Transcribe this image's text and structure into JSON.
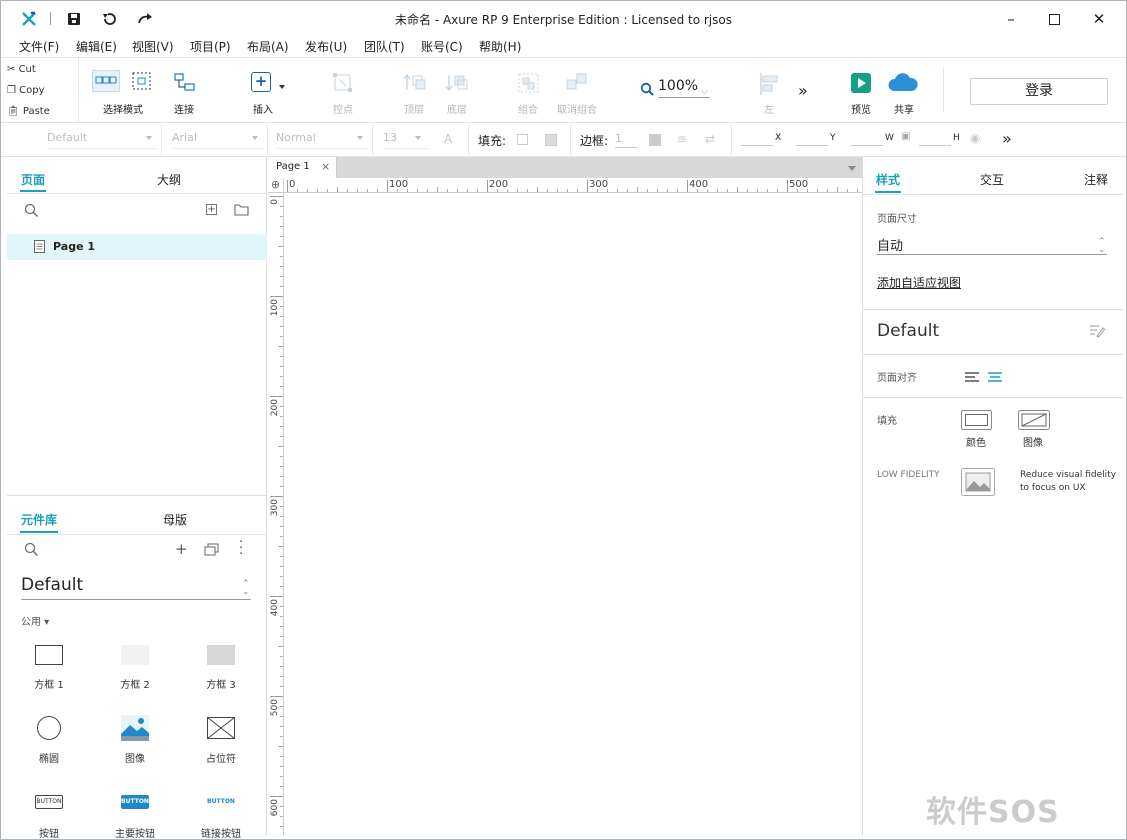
{
  "window": {
    "title": "未命名 - Axure RP 9 Enterprise Edition : Licensed to rjsos"
  },
  "menu": [
    "文件(F)",
    "编辑(E)",
    "视图(V)",
    "项目(P)",
    "布局(A)",
    "发布(U)",
    "团队(T)",
    "账号(C)",
    "帮助(H)"
  ],
  "clipboard": {
    "cut": "Cut",
    "copy": "Copy",
    "paste": "Paste"
  },
  "toolbar": {
    "select_mode": "选择模式",
    "connect": "连接",
    "insert": "插入",
    "point": "控点",
    "front": "顶层",
    "back": "底层",
    "group": "组合",
    "ungroup": "取消组合",
    "zoom": "100%",
    "left": "左",
    "preview": "预览",
    "share": "共享",
    "login": "登录"
  },
  "format": {
    "style": "Default",
    "font": "Arial",
    "weight": "Normal",
    "size": "13",
    "fill_label": "填充:",
    "border_label": "边框:",
    "border_value": "1",
    "x": "X",
    "y": "Y",
    "w": "W",
    "h": "H"
  },
  "left_top": {
    "tabs": [
      "页面",
      "大纲"
    ],
    "pages": [
      {
        "name": "Page 1",
        "selected": true
      }
    ]
  },
  "left_bottom": {
    "tabs": [
      "元件库",
      "母版"
    ],
    "library": "Default",
    "category": "公用",
    "widgets": [
      {
        "label": "方框 1",
        "icon": "box-1-icon"
      },
      {
        "label": "方框 2",
        "icon": "box-2-icon"
      },
      {
        "label": "方框 3",
        "icon": "box-3-icon"
      },
      {
        "label": "椭圆",
        "icon": "ellipse-icon"
      },
      {
        "label": "图像",
        "icon": "image-icon"
      },
      {
        "label": "占位符",
        "icon": "placeholder-icon"
      },
      {
        "label": "按钮",
        "icon": "button-icon",
        "text": "BUTTON"
      },
      {
        "label": "主要按钮",
        "icon": "primary-button-icon",
        "text": "BUTTON"
      },
      {
        "label": "链接按钮",
        "icon": "link-button-icon",
        "text": "BUTTON"
      }
    ]
  },
  "canvas": {
    "tab": "Page 1",
    "ruler_h": [
      "0",
      "100",
      "200",
      "300",
      "400",
      "500"
    ],
    "ruler_v": [
      "0",
      "100",
      "200",
      "300",
      "400",
      "500",
      "600"
    ]
  },
  "right": {
    "tabs": [
      "样式",
      "交互",
      "注释"
    ],
    "page_size_label": "页面尺寸",
    "page_size_value": "自动",
    "adaptive_link": "添加自适应视图",
    "style_name": "Default",
    "align_label": "页面对齐",
    "fill_label": "填充",
    "fill_color": "颜色",
    "fill_image": "图像",
    "low_fidelity": "LOW FIDELITY",
    "low_fidelity_desc": "Reduce visual fidelity to focus on UX"
  },
  "watermark": "软件SOS",
  "colors": {
    "accent": "#1aa0b9",
    "green": "#16a085",
    "blue": "#2d8fd5"
  }
}
